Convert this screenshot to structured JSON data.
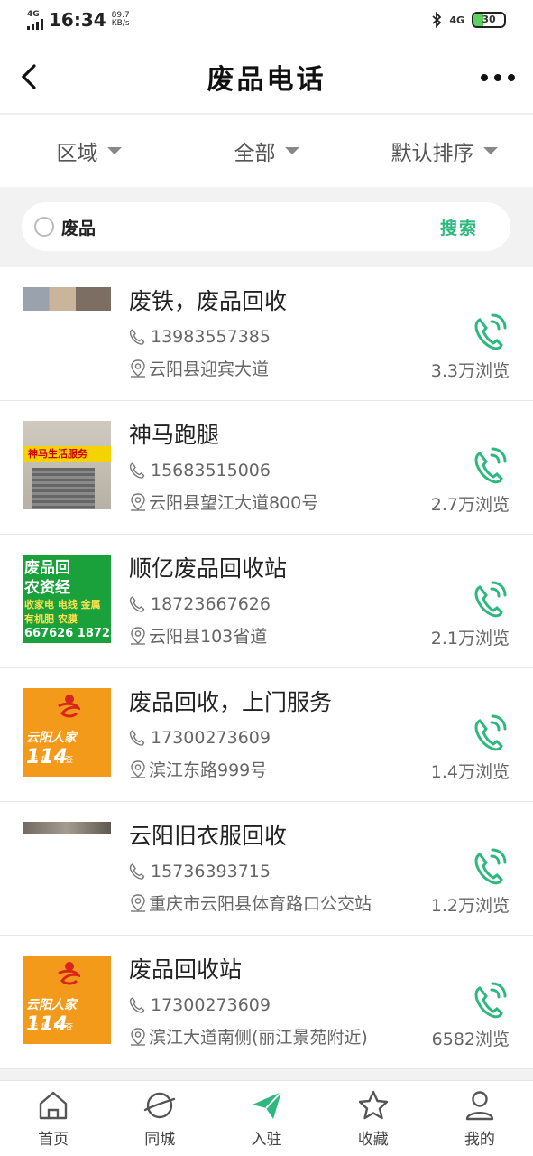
{
  "status_bar": {
    "network": "4G",
    "time": "16:34",
    "speed_value": "89.7",
    "speed_unit": "KB/s",
    "network_right": "4G",
    "battery": "30"
  },
  "header": {
    "title": "废品电话"
  },
  "filters": [
    {
      "label": "区域"
    },
    {
      "label": "全部"
    },
    {
      "label": "默认排序"
    }
  ],
  "search": {
    "value": "废品",
    "button_label": "搜索"
  },
  "listings": [
    {
      "name": "废铁，废品回收",
      "phone": "13983557385",
      "address": "云阳县迎宾大道",
      "views": "3.3万浏览"
    },
    {
      "name": "神马跑腿",
      "phone": "15683515006",
      "address": "云阳县望江大道800号",
      "views": "2.7万浏览",
      "sign_text": "神马生活服务"
    },
    {
      "name": "顺亿废品回收站",
      "phone": "18723667626",
      "address": "云阳县103省道",
      "views": "2.1万浏览"
    },
    {
      "name": "废品回收，上门服务",
      "phone": "17300273609",
      "address": "滨江东路999号",
      "views": "1.4万浏览",
      "logo_text": "云阳人家",
      "logo_num": "114",
      "logo_sub": "无所不查"
    },
    {
      "name": "云阳旧衣服回收",
      "phone": "15736393715",
      "address": "重庆市云阳县体育路口公交站",
      "views": "1.2万浏览"
    },
    {
      "name": "废品回收站",
      "phone": "17300273609",
      "address": "滨江大道南侧(丽江景苑附近)",
      "views": "6582浏览",
      "logo_text": "云阳人家",
      "logo_num": "114",
      "logo_sub": "无所不查"
    }
  ],
  "tabbar": [
    {
      "label": "首页",
      "icon": "home-icon"
    },
    {
      "label": "同城",
      "icon": "planet-icon"
    },
    {
      "label": "入驻",
      "icon": "paper-plane-icon"
    },
    {
      "label": "收藏",
      "icon": "star-icon"
    },
    {
      "label": "我的",
      "icon": "user-icon"
    }
  ],
  "colors": {
    "accent": "#2db97d",
    "active_tab": "#2db97d"
  }
}
